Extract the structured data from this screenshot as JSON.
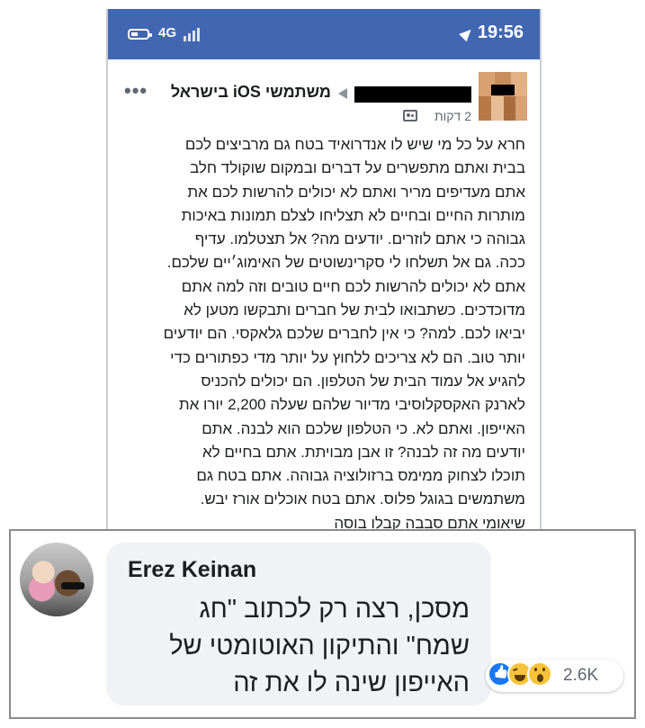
{
  "status_bar": {
    "network": "4G",
    "time": "19:56"
  },
  "post": {
    "group_name": "משתמשי iOS בישראל",
    "time_ago": "2 דקות",
    "body_lines": [
      "חרא על כל מי שיש לו אנדרואיד בטח גם מרביצים לכם",
      "בבית ואתם מתפשרים על דברים ובמקום שוקולד חלב",
      "אתם מעדיפים מריר ואתם לא יכולים להרשות לכם את",
      "מותרות החיים ובחיים לא תצליחו לצלם תמונות באיכות",
      "גבוהה כי אתם לוזרים. יודעים מה? אל תצטלמו. עדיף",
      "ככה. גם אל תשלחו לי סקרינשוטים של האימוג׳יים שלכם.",
      "אתם לא יכולים להרשות לכם חיים טובים וזה למה אתם",
      "מדוכדכים. כשתבואו לבית של חברים ותבקשו מטען לא",
      "יביאו לכם. למה? כי אין לחברים שלכם גלאקסי. הם יודעים",
      "יותר טוב. הם לא צריכים ללחוץ על יותר מדי כפתורים כדי",
      "להגיע אל עמוד הבית של הטלפון. הם יכולים להכניס",
      "לארנק האקסקלוסיבי מדיור שלהם שעלה 2,200 יורו את",
      "האייפון. ואתם לא. כי הטלפון שלכם הוא לבנה. אתם",
      "יודעים מה זה לבנה? זו אבן מבויתת. אתם בחיים לא",
      "תוכלו לצחוק ממימס ברזולוציה גבוהה. אתם בטח גם",
      "משתמשים בגוגל פלוס. אתם בטח אוכלים אורז יבש.",
      "שיאומי אתם סבבה קבלו בוסה"
    ]
  },
  "comment": {
    "author": "Erez Keinan",
    "text_lines": [
      "מסכן, רצה רק לכתוב \"חג",
      "שמח\" והתיקון האוטומטי של",
      "האייפון שינה לו את זה"
    ],
    "reaction_count": "2.6K",
    "reactions": [
      "like-icon",
      "haha-icon",
      "wow-icon"
    ]
  },
  "colors": {
    "facebook_blue": "#4267b2",
    "bubble_gray": "#f0f2f5",
    "like_blue": "#1877f2",
    "emoji_yellow": "#f7c33a"
  }
}
